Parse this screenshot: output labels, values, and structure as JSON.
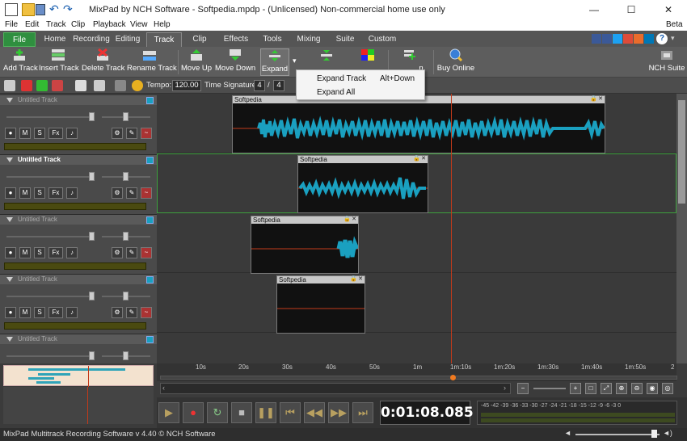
{
  "titlebar": {
    "title": "MixPad by NCH Software - Softpedia.mpdp - (Unlicensed) Non-commercial home use only"
  },
  "menu": [
    "File",
    "Edit",
    "Track",
    "Clip",
    "Playback",
    "View",
    "Help"
  ],
  "menu_right": "Beta",
  "tabs": [
    "File",
    "Home",
    "Recording",
    "Editing",
    "Track",
    "Clip",
    "Effects",
    "Tools",
    "Mixing",
    "Suite",
    "Custom"
  ],
  "toolbar": {
    "add_track": "Add Track",
    "insert_track": "Insert Track",
    "delete_track": "Delete Track",
    "rename_track": "Rename Track",
    "move_up": "Move Up",
    "move_down": "Move Down",
    "expand": "Expand",
    "buy_online": "Buy Online",
    "nch_suite": "NCH Suite",
    "partial_label": "n"
  },
  "dropdown": {
    "items": [
      {
        "label": "Expand Track",
        "shortcut": "Alt+Down"
      },
      {
        "label": "Expand All",
        "shortcut": ""
      }
    ]
  },
  "toolbar2": {
    "tempo_label": "Tempo:",
    "tempo_value": "120.00",
    "time_sig_label": "Time Signature:",
    "time_sig_num": "4",
    "time_sig_sep": "/",
    "time_sig_den": "4"
  },
  "tracks": [
    {
      "name": "Untitled Track",
      "selected": false
    },
    {
      "name": "Untitled Track",
      "selected": true
    },
    {
      "name": "Untitled Track",
      "selected": false
    },
    {
      "name": "Untitled Track",
      "selected": false
    },
    {
      "name": "Untitled Track",
      "selected": false
    }
  ],
  "track_buttons": {
    "mute": "M",
    "solo": "S",
    "fx": "Fx"
  },
  "clips": [
    {
      "name": "Softpedia"
    },
    {
      "name": "Softpedia"
    },
    {
      "name": "Softpedia"
    },
    {
      "name": "Softpedia"
    }
  ],
  "ruler": {
    "labels": [
      "10s",
      "20s",
      "30s",
      "40s",
      "50s",
      "1m",
      "1m:10s",
      "1m:20s",
      "1m:30s",
      "1m:40s",
      "1m:50s",
      "2"
    ]
  },
  "transport": {
    "time": "0:01:08.085",
    "vu_scale": "-45 -42 -39 -36 -33 -30 -27 -24 -21 -18 -15 -12 -9 -6 -3 0"
  },
  "status": {
    "text": "MixPad Multitrack Recording Software v 4.40 © NCH Software"
  },
  "colors": {
    "accent_green": "#2f8f3f",
    "waveform": "#1aa0c0",
    "playhead": "#c23a1a"
  },
  "icons": [
    "app-icon",
    "save-icon",
    "undo-icon",
    "redo-icon",
    "help-icon",
    "search-icon",
    "play-icon",
    "record-icon",
    "stop-icon",
    "pause-icon"
  ]
}
